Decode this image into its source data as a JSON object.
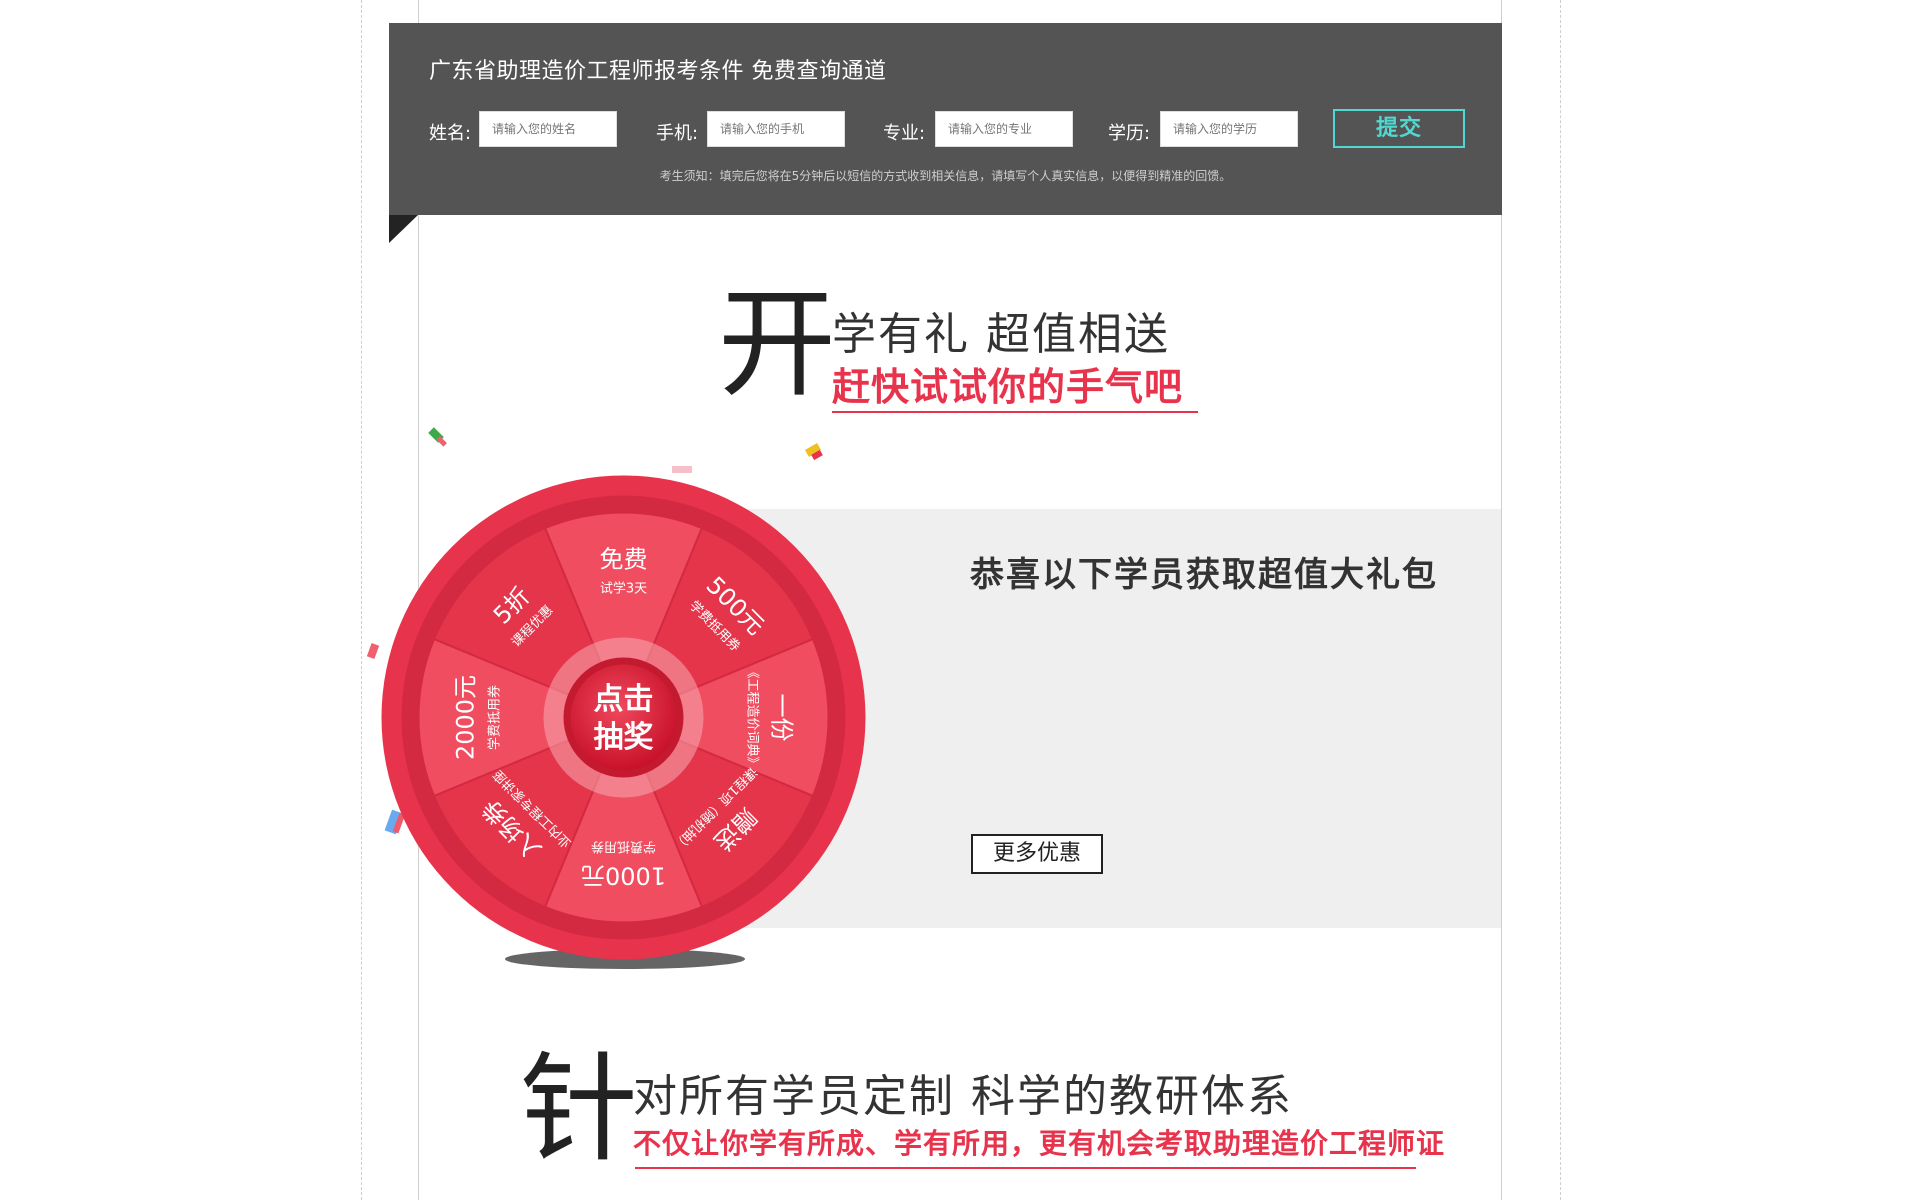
{
  "form": {
    "title": "广东省助理造价工程师报考条件  免费查询通道",
    "fields": [
      {
        "label": "姓名:",
        "placeholder": "请输入您的姓名"
      },
      {
        "label": "手机:",
        "placeholder": "请输入您的手机"
      },
      {
        "label": "专业:",
        "placeholder": "请输入您的专业"
      },
      {
        "label": "学历:",
        "placeholder": "请输入您的学历"
      }
    ],
    "submit_label": "提交",
    "notice": "考生须知：填完后您将在5分钟后以短信的方式收到相关信息，请填写个人真实信息，以便得到精准的回馈。"
  },
  "gift": {
    "big_char": "开",
    "title": "学有礼  超值相送",
    "subtitle": "赶快试试你的手气吧"
  },
  "wheel": {
    "center_label_line1": "点击",
    "center_label_line2": "抽奖",
    "segments": [
      {
        "main": "免费",
        "sub": "试学3天"
      },
      {
        "main": "500元",
        "sub": "学费抵用券"
      },
      {
        "main": "一份",
        "sub": "《工程造价词典》"
      },
      {
        "main": "赠送",
        "sub": "课程1项（随机抽）"
      },
      {
        "main": "1000元",
        "sub": "学费抵用券"
      },
      {
        "main": "入场券",
        "sub": "业内工程专家讲座"
      },
      {
        "main": "2000元",
        "sub": "学费抵用券"
      },
      {
        "main": "5折",
        "sub": "课程优惠"
      }
    ],
    "colors": {
      "rim": "#e8334c",
      "segment_a": "#f04d60",
      "segment_b": "#e5354a",
      "center": "#d81f36"
    }
  },
  "winners": {
    "title": "恭喜以下学员获取超值大礼包",
    "more_label": "更多优惠"
  },
  "research": {
    "big_char": "针",
    "title": "对所有学员定制 科学的教研体系",
    "subtitle": "不仅让你学有所成、学有所用，更有机会考取助理造价工程师证"
  },
  "colors": {
    "accent_red": "#e8334c",
    "accent_teal": "#4fd9d2",
    "band_grey": "#545454"
  }
}
